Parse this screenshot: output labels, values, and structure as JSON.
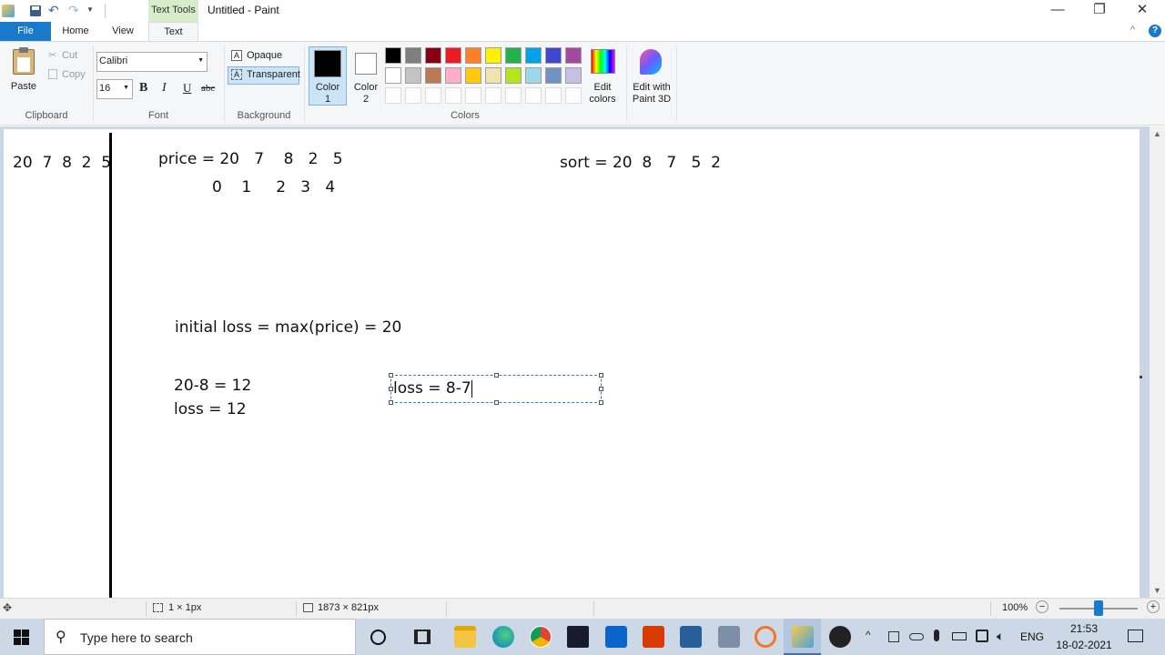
{
  "titlebar": {
    "context_tab": "Text Tools",
    "title": "Untitled - Paint",
    "min_symbol": "—",
    "restore_symbol": "❐",
    "close_symbol": "✕"
  },
  "tabs": [
    "File",
    "Home",
    "View",
    "Text"
  ],
  "help_symbol": "?",
  "collapse_symbol": "^",
  "clipboard": {
    "paste": "Paste",
    "cut": "Cut",
    "copy": "Copy",
    "group": "Clipboard"
  },
  "font": {
    "family": "Calibri",
    "size": "16",
    "bold": "B",
    "italic": "I",
    "underline": "U",
    "strikethrough": "abc",
    "group": "Font"
  },
  "background": {
    "opaque": "Opaque",
    "transparent": "Transparent",
    "group": "Background"
  },
  "colors": {
    "color1_line1": "Color",
    "color1_line2": "1",
    "color2_line1": "Color",
    "color2_line2": "2",
    "edit_line1": "Edit",
    "edit_line2": "colors",
    "paint3d_line1": "Edit with",
    "paint3d_line2": "Paint 3D",
    "group": "Colors",
    "palette_row1": [
      "#000000",
      "#7f7f7f",
      "#880015",
      "#ed1c24",
      "#ff7f27",
      "#fff200",
      "#22b14c",
      "#00a2e8",
      "#3f48cc",
      "#a349a4"
    ],
    "palette_row2": [
      "#ffffff",
      "#c3c3c3",
      "#b97a57",
      "#ffaec9",
      "#ffc90e",
      "#efe4b0",
      "#b5e61d",
      "#99d9ea",
      "#7092be",
      "#c8bfe7"
    ],
    "color1_value": "#000000",
    "color2_value": "#ffffff"
  },
  "canvas_text": {
    "left_array": "20  7  8  2  5",
    "price_line": "price = 20   7    8   2   5",
    "index_line": "0    1     2   3   4",
    "sort_line": "sort = 20  8   7   5  2",
    "initial_loss": "initial loss = max(price) = 20",
    "calc_line": "20-8 = 12",
    "loss_line": "loss = 12",
    "textbox_value": "loss = 8-7"
  },
  "status": {
    "selection_size": "1 × 1px",
    "canvas_size": "1873 × 821px",
    "zoom": "100%",
    "zoom_minus": "−",
    "zoom_plus": "+",
    "zoom_level": 0.5
  },
  "taskbar": {
    "search_placeholder": "Type here to search",
    "language": "ENG",
    "time": "21:53",
    "date": "18-02-2021"
  }
}
